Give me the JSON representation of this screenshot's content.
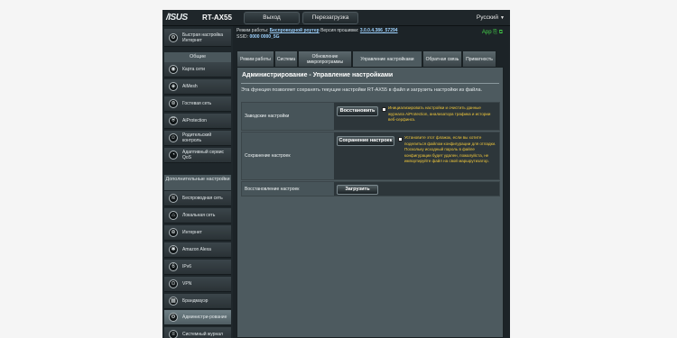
{
  "header": {
    "brand": "/ISUS",
    "model": "RT-AX55",
    "logout_label": "Выход",
    "reboot_label": "Перезагрузка",
    "language_label": "Русский"
  },
  "status": {
    "mode_label": "Режим работы:",
    "mode_value": "Беспроводной роутер",
    "firmware_label": "Версия прошивки:",
    "firmware_value": "3.0.0.4.386_57294",
    "ssid_label": "SSID:",
    "ssid_values": [
      "0000",
      "0000_5G"
    ],
    "app_label": "App"
  },
  "sidebar": {
    "quick_setup": "Быстрая настройка Интернет",
    "general_header": "Общие",
    "general_items": [
      {
        "label": "Карта сети",
        "icon": "network-map-icon"
      },
      {
        "label": "AiMesh",
        "icon": "aimesh-icon"
      },
      {
        "label": "Гостевая сеть",
        "icon": "guest-network-icon"
      },
      {
        "label": "AiProtection",
        "icon": "shield-icon"
      },
      {
        "label": "Родительский контроль",
        "icon": "parental-control-icon"
      },
      {
        "label": "Адаптивный сервис QoS",
        "icon": "qos-icon"
      }
    ],
    "advanced_header": "Дополнительные настройки",
    "advanced_items": [
      {
        "label": "Беспроводная сеть",
        "icon": "wireless-icon"
      },
      {
        "label": "Локальная сеть",
        "icon": "lan-icon"
      },
      {
        "label": "Интернет",
        "icon": "globe-icon"
      },
      {
        "label": "Amazon Alexa",
        "icon": "alexa-icon"
      },
      {
        "label": "IPv6",
        "icon": "ipv6-icon"
      },
      {
        "label": "VPN",
        "icon": "vpn-icon"
      },
      {
        "label": "Брандмауэр",
        "icon": "firewall-icon"
      },
      {
        "label": "Администри-рование",
        "icon": "admin-icon"
      },
      {
        "label": "Системный журнал",
        "icon": "syslog-icon"
      }
    ]
  },
  "tabs": [
    {
      "label": "Режим работы"
    },
    {
      "label": "Система"
    },
    {
      "label": "Обновление микропрограммы"
    },
    {
      "label": "Управление настройками"
    },
    {
      "label": "Обратная связь"
    },
    {
      "label": "Приватность"
    }
  ],
  "panel": {
    "title": "Администрирование - Управление настройками",
    "description": "Эта функция позволяет сохранять текущие настройки RT-AX55 в файл и загрузить настройки из файла.",
    "rows": [
      {
        "label": "Заводские настройки",
        "button": "Восстановить",
        "note": "Инициализировать настройки и очистить данные журнала AiProtection, анализатора трафика и истории веб-серфинга."
      },
      {
        "label": "Сохранение настроек",
        "button": "Сохранение настроек",
        "note": "Установите этот флажок, если вы хотите поделиться файлом конфигурации для отладки. Поскольку исходный пароль в файле конфигурации будет удален, пожалуйста, не импортируйте файл на свой маршрутизатор."
      },
      {
        "label": "Восстановление настроек",
        "button": "Загрузить",
        "note": ""
      }
    ]
  }
}
